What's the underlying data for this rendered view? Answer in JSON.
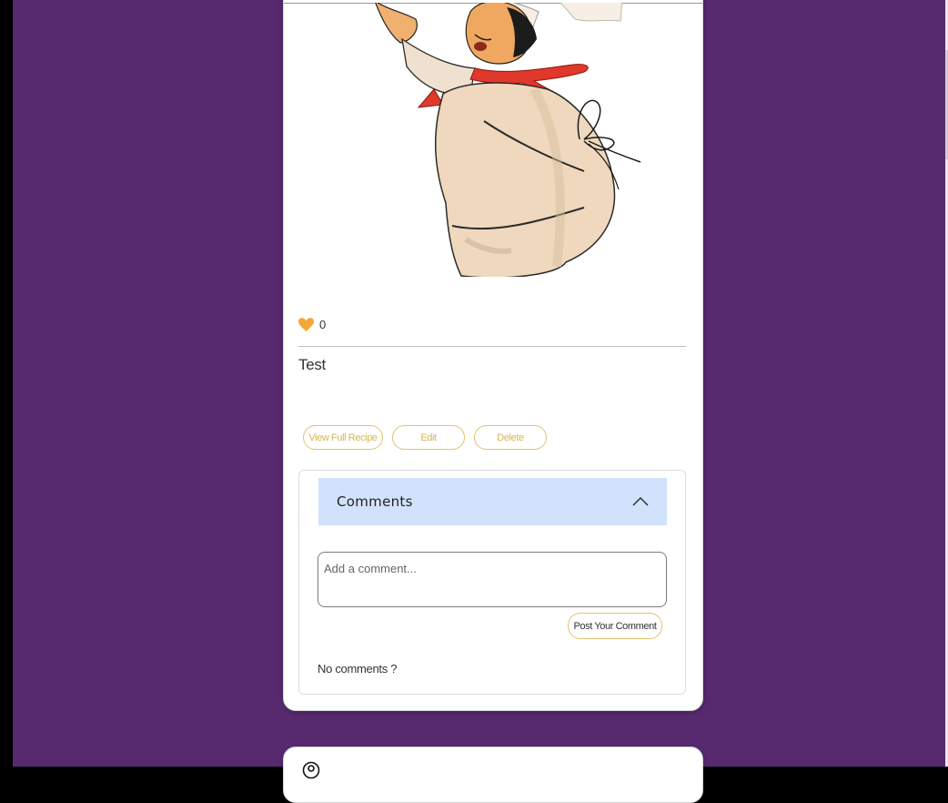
{
  "post": {
    "image_alt": "Cartoon chef illustration",
    "likes_icon": "heart-icon",
    "likes_count": "0",
    "title": "Test",
    "actions": {
      "view_full_recipe": "View Full Recipe",
      "edit": "Edit",
      "delete": "Delete"
    },
    "comments": {
      "header": "Comments",
      "toggle_icon": "chevron-up-icon",
      "input_placeholder": "Add a comment...",
      "input_value": "",
      "post_button": "Post Your Comment",
      "empty_text": "No comments ?"
    }
  },
  "next_post": {
    "author_icon": "user-circle-icon",
    "author": "",
    "date": ""
  },
  "colors": {
    "background": "#572a70",
    "accent_border": "#e2c36c",
    "accent_text": "#d9b64e",
    "comments_header_bg": "#d1e2fc",
    "heart": "#f2a93b"
  }
}
